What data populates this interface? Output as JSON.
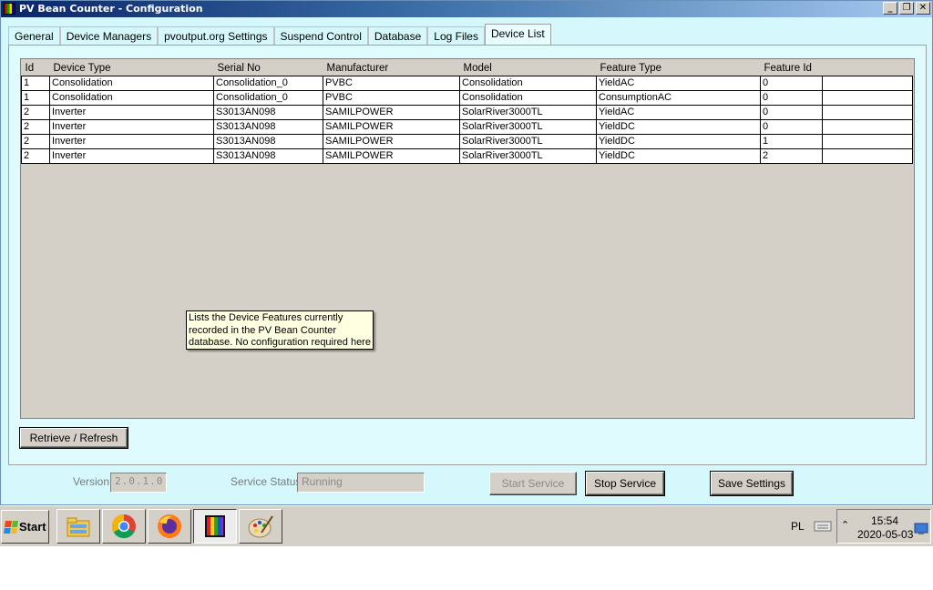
{
  "window": {
    "title": "PV Bean Counter - Configuration"
  },
  "tabs": [
    "General",
    "Device Managers",
    "pvoutput.org Settings",
    "Suspend Control",
    "Database",
    "Log Files",
    "Device List"
  ],
  "active_tab": "Device List",
  "grid": {
    "columns": [
      "Id",
      "Device Type",
      "Serial No",
      "Manufacturer",
      "Model",
      "Feature Type",
      "Feature Id"
    ],
    "rows": [
      [
        "1",
        "Consolidation",
        "Consolidation_0",
        "PVBC",
        "Consolidation",
        "YieldAC",
        "0"
      ],
      [
        "1",
        "Consolidation",
        "Consolidation_0",
        "PVBC",
        "Consolidation",
        "ConsumptionAC",
        "0"
      ],
      [
        "2",
        "Inverter",
        "S3013AN098",
        "SAMILPOWER",
        "SolarRiver3000TL",
        "YieldAC",
        "0"
      ],
      [
        "2",
        "Inverter",
        "S3013AN098",
        "SAMILPOWER",
        "SolarRiver3000TL",
        "YieldDC",
        "0"
      ],
      [
        "2",
        "Inverter",
        "S3013AN098",
        "SAMILPOWER",
        "SolarRiver3000TL",
        "YieldDC",
        "1"
      ],
      [
        "2",
        "Inverter",
        "S3013AN098",
        "SAMILPOWER",
        "SolarRiver3000TL",
        "YieldDC",
        "2"
      ]
    ]
  },
  "tooltip": {
    "line1": "Lists the Device Features currently",
    "line2": "recorded in the PV Bean Counter",
    "line3": "database. No configuration required here"
  },
  "buttons": {
    "refresh": "Retrieve / Refresh",
    "start_service": "Start Service",
    "stop_service": "Stop Service",
    "save_settings": "Save Settings"
  },
  "footer": {
    "version_label": "Version",
    "version_value": "2.0.1.0",
    "status_label": "Service Status",
    "status_value": "Running"
  },
  "taskbar": {
    "start_label": "Start",
    "apps": [
      "file-explorer-icon",
      "chrome-icon",
      "firefox-icon",
      "pv-bean-counter-icon",
      "paint-icon"
    ],
    "language": "PL",
    "time": "15:54",
    "date": "2020-05-03"
  }
}
